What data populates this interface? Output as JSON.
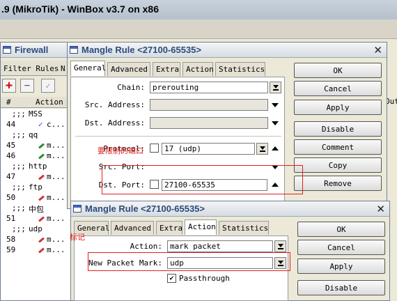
{
  "app": {
    "title": ".9 (MikroTik) - WinBox v3.7 on x86"
  },
  "firewall": {
    "title": "Firewall",
    "tabs": [
      "Filter Rules",
      "N"
    ],
    "toolbar": {
      "add": "+",
      "remove": "−",
      "enable": "✓"
    },
    "columns": [
      "#",
      "Action"
    ],
    "rows": [
      {
        "num": ";;;",
        "text": "MSS",
        "type": "comment"
      },
      {
        "num": "44",
        "text": "c...",
        "type": "check"
      },
      {
        "num": ";;;",
        "text": "qq",
        "type": "comment"
      },
      {
        "num": "45",
        "text": "m...",
        "type": "green"
      },
      {
        "num": "46",
        "text": "m...",
        "type": "green"
      },
      {
        "num": ";;;",
        "text": "http",
        "type": "comment"
      },
      {
        "num": "47",
        "text": "m...",
        "type": "red"
      },
      {
        "num": ";;;",
        "text": "ftp",
        "type": "comment"
      },
      {
        "num": "50",
        "text": "m...",
        "type": "red"
      },
      {
        "num": ";;;",
        "text": "中包",
        "type": "comment"
      },
      {
        "num": "51",
        "text": "m...",
        "type": "red"
      },
      {
        "num": ";;;",
        "text": "udp",
        "type": "comment"
      },
      {
        "num": "58",
        "text": "m...",
        "type": "red"
      },
      {
        "num": "59",
        "text": "m...",
        "type": "red"
      }
    ],
    "right_col_header": "Out"
  },
  "rule1": {
    "title": "Mangle Rule <27100-65535>",
    "tabs": [
      "General",
      "Advanced",
      "Extra",
      "Action",
      "Statistics"
    ],
    "chain_label": "Chain:",
    "chain_value": "prerouting",
    "src_address_label": "Src. Address:",
    "dst_address_label": "Dst. Address:",
    "protocol_label": "Protocol:",
    "protocol_value": "17 (udp)",
    "src_port_label": "Src. Port:",
    "dst_port_label": "Dst. Port:",
    "dst_port_value": "27100-65535",
    "buttons": [
      "OK",
      "Cancel",
      "Apply",
      "Disable",
      "Comment",
      "Copy",
      "Remove"
    ]
  },
  "rule2": {
    "title": "Mangle Rule <27100-65535>",
    "tabs": [
      "General",
      "Advanced",
      "Extra",
      "Action",
      "Statistics"
    ],
    "action_label": "Action:",
    "action_value": "mark packet",
    "new_packet_mark_label": "New Packet Mark:",
    "new_packet_mark_value": "udp",
    "passthrough_label": "Passthrough",
    "passthrough_checked": true,
    "buttons": [
      "OK",
      "Cancel",
      "Apply",
      "Disable"
    ]
  },
  "annotations": {
    "port_note": "要限制的端口",
    "mark_note": "标记"
  },
  "colors": {
    "annotation_red": "#e02020",
    "title_blue": "#2d4b7a"
  }
}
